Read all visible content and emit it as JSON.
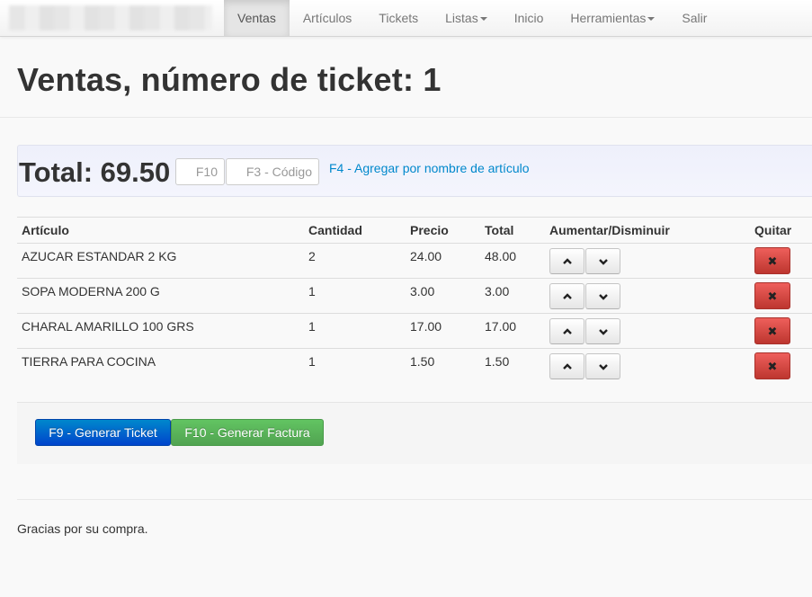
{
  "navbar": {
    "items": [
      {
        "label": "Ventas",
        "active": true
      },
      {
        "label": "Artículos"
      },
      {
        "label": "Tickets"
      },
      {
        "label": "Listas",
        "dropdown": true
      },
      {
        "label": "Inicio"
      },
      {
        "label": "Herramientas",
        "dropdown": true
      },
      {
        "label": "Salir"
      }
    ]
  },
  "page": {
    "title": "Ventas, número de ticket: 1"
  },
  "sale": {
    "total_label": "Total: 69.50",
    "f10_placeholder": "F10",
    "code_placeholder": "F3 - Código",
    "add_by_name_link": "F4 - Agregar por nombre de artículo"
  },
  "table": {
    "headers": {
      "article": "Artículo",
      "quantity": "Cantidad",
      "price": "Precio",
      "total": "Total",
      "adjust": "Aumentar/Disminuir",
      "remove": "Quitar"
    },
    "rows": [
      {
        "article": "AZUCAR ESTANDAR 2 KG",
        "quantity": "2",
        "price": "24.00",
        "total": "48.00"
      },
      {
        "article": "SOPA MODERNA 200 G",
        "quantity": "1",
        "price": "3.00",
        "total": "3.00"
      },
      {
        "article": "CHARAL AMARILLO 100 GRS",
        "quantity": "1",
        "price": "17.00",
        "total": "17.00"
      },
      {
        "article": "TIERRA PARA COCINA",
        "quantity": "1",
        "price": "1.50",
        "total": "1.50"
      }
    ]
  },
  "actions": {
    "generate_ticket": "F9 - Generar Ticket",
    "generate_invoice": "F10 - Generar Factura"
  },
  "footer": {
    "message": "Gracias por su compra."
  },
  "icons": {
    "increase": "chevron-up-icon",
    "decrease": "chevron-down-icon",
    "remove": "close-icon"
  },
  "colors": {
    "link": "#0088cc",
    "primary": "#0055cc",
    "success": "#5bb75b",
    "danger": "#da4f49"
  }
}
